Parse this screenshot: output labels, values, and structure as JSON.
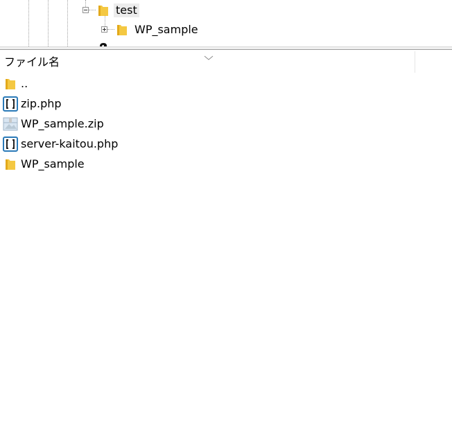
{
  "tree": {
    "nodes": [
      {
        "label": "test",
        "state": "expanded",
        "selected": true
      },
      {
        "label": "WP_sample",
        "state": "collapsed",
        "selected": false
      }
    ]
  },
  "list": {
    "column_name": "ファイル名",
    "rows": [
      {
        "label": "..",
        "icon": "folder-icon"
      },
      {
        "label": "zip.php",
        "icon": "php-file-icon"
      },
      {
        "label": "WP_sample.zip",
        "icon": "zip-file-icon"
      },
      {
        "label": "server-kaitou.php",
        "icon": "php-file-icon"
      },
      {
        "label": "WP_sample",
        "icon": "folder-icon"
      }
    ]
  },
  "colors": {
    "folder": "#f4c842",
    "folder_dark": "#e2a91b",
    "php_icon": "#2a7ab8",
    "selection_bg": "#ececec"
  }
}
